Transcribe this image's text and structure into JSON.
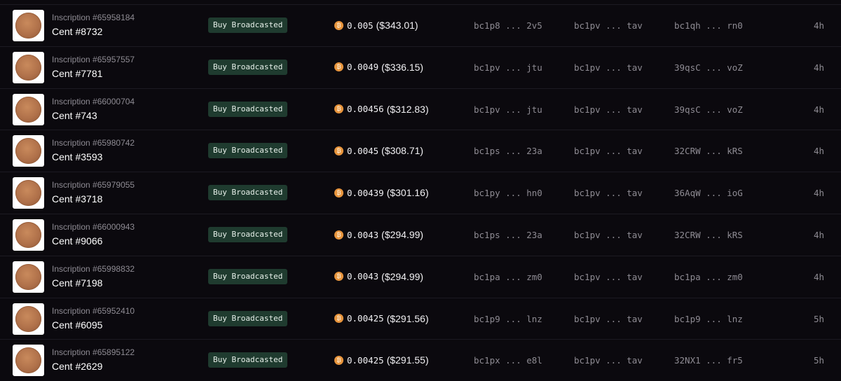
{
  "activity": {
    "rows": [
      {
        "inscription": "Inscription #65958184",
        "name": "Cent #8732",
        "status": "Buy Broadcasted",
        "btc": "0.005",
        "usd": "($343.01)",
        "from": "bc1p8 ... 2v5",
        "to": "bc1pv ... tav",
        "buyer": "bc1qh ... rn0",
        "time": "4h",
        "image_icon": "penny-coin-image"
      },
      {
        "inscription": "Inscription #65957557",
        "name": "Cent #7781",
        "status": "Buy Broadcasted",
        "btc": "0.0049",
        "usd": "($336.15)",
        "from": "bc1pv ... jtu",
        "to": "bc1pv ... tav",
        "buyer": "39qsC ... voZ",
        "time": "4h",
        "image_icon": "penny-coin-image"
      },
      {
        "inscription": "Inscription #66000704",
        "name": "Cent #743",
        "status": "Buy Broadcasted",
        "btc": "0.00456",
        "usd": "($312.83)",
        "from": "bc1pv ... jtu",
        "to": "bc1pv ... tav",
        "buyer": "39qsC ... voZ",
        "time": "4h",
        "image_icon": "penny-coin-image"
      },
      {
        "inscription": "Inscription #65980742",
        "name": "Cent #3593",
        "status": "Buy Broadcasted",
        "btc": "0.0045",
        "usd": "($308.71)",
        "from": "bc1ps ... 23a",
        "to": "bc1pv ... tav",
        "buyer": "32CRW ... kRS",
        "time": "4h",
        "image_icon": "penny-coin-image"
      },
      {
        "inscription": "Inscription #65979055",
        "name": "Cent #3718",
        "status": "Buy Broadcasted",
        "btc": "0.00439",
        "usd": "($301.16)",
        "from": "bc1py ... hn0",
        "to": "bc1pv ... tav",
        "buyer": "36AqW ... ioG",
        "time": "4h",
        "image_icon": "penny-coin-image"
      },
      {
        "inscription": "Inscription #66000943",
        "name": "Cent #9066",
        "status": "Buy Broadcasted",
        "btc": "0.0043",
        "usd": "($294.99)",
        "from": "bc1ps ... 23a",
        "to": "bc1pv ... tav",
        "buyer": "32CRW ... kRS",
        "time": "4h",
        "image_icon": "penny-coin-image"
      },
      {
        "inscription": "Inscription #65998832",
        "name": "Cent #7198",
        "status": "Buy Broadcasted",
        "btc": "0.0043",
        "usd": "($294.99)",
        "from": "bc1pa ... zm0",
        "to": "bc1pv ... tav",
        "buyer": "bc1pa ... zm0",
        "time": "4h",
        "image_icon": "penny-coin-image"
      },
      {
        "inscription": "Inscription #65952410",
        "name": "Cent #6095",
        "status": "Buy Broadcasted",
        "btc": "0.00425",
        "usd": "($291.56)",
        "from": "bc1p9 ... lnz",
        "to": "bc1pv ... tav",
        "buyer": "bc1p9 ... lnz",
        "time": "5h",
        "image_icon": "penny-coin-image"
      },
      {
        "inscription": "Inscription #65895122",
        "name": "Cent #2629",
        "status": "Buy Broadcasted",
        "btc": "0.00425",
        "usd": "($291.55)",
        "from": "bc1px ... e8l",
        "to": "bc1pv ... tav",
        "buyer": "32NX1 ... fr5",
        "time": "5h",
        "image_icon": "penny-coin-image"
      }
    ],
    "currency_icon": "bitcoin-icon",
    "currency_glyph": "₿",
    "colors": {
      "background": "#0b090e",
      "badge_bg": "#1f3b2f",
      "bitcoin": "#e8953d",
      "muted_text": "#8e8b93"
    }
  }
}
